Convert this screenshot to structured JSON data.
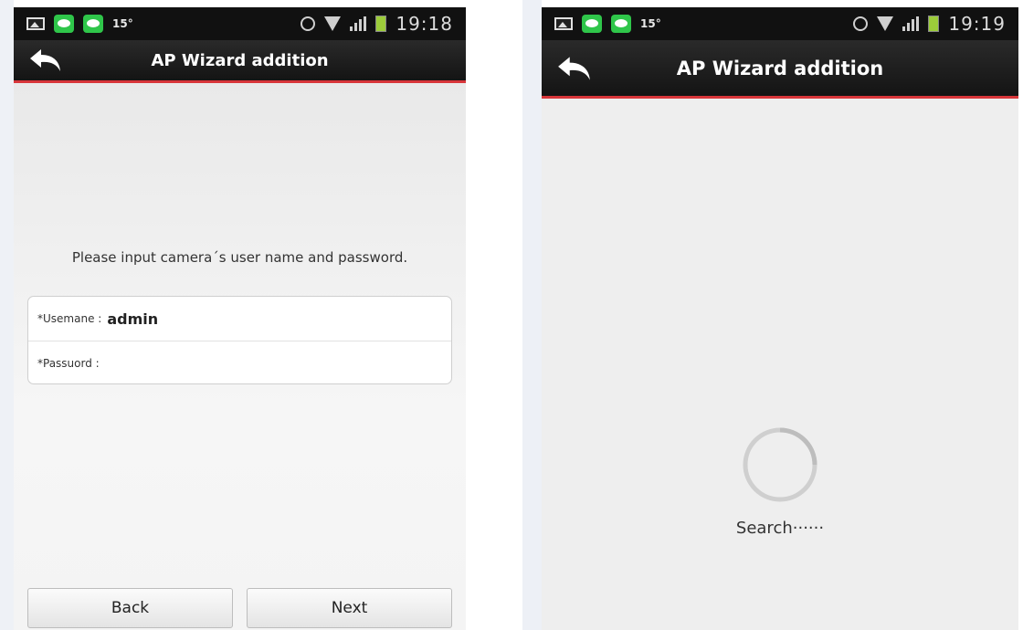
{
  "left_screen": {
    "status_bar": {
      "temperature": "15°",
      "time": "19:18"
    },
    "title": "AP Wizard addition",
    "instruction": "Please input camera´s user name and password.",
    "username": {
      "label": "*Usemane :",
      "value": "admin"
    },
    "password": {
      "label": "*Passuord :",
      "value": ""
    },
    "buttons": {
      "back": "Back",
      "next": "Next"
    }
  },
  "right_screen": {
    "status_bar": {
      "temperature": "15°",
      "time": "19:19"
    },
    "title": "AP Wizard addition",
    "status_text": "Search······"
  },
  "colors": {
    "accent_red": "#d8363a",
    "line_green": "#2fc64a",
    "bar_dark": "#111111"
  },
  "icons": [
    "gallery-icon",
    "line-app-icon",
    "alarm-icon",
    "wifi-icon",
    "signal-icon",
    "battery-icon",
    "back-arrow-icon",
    "loading-spinner-icon"
  ]
}
